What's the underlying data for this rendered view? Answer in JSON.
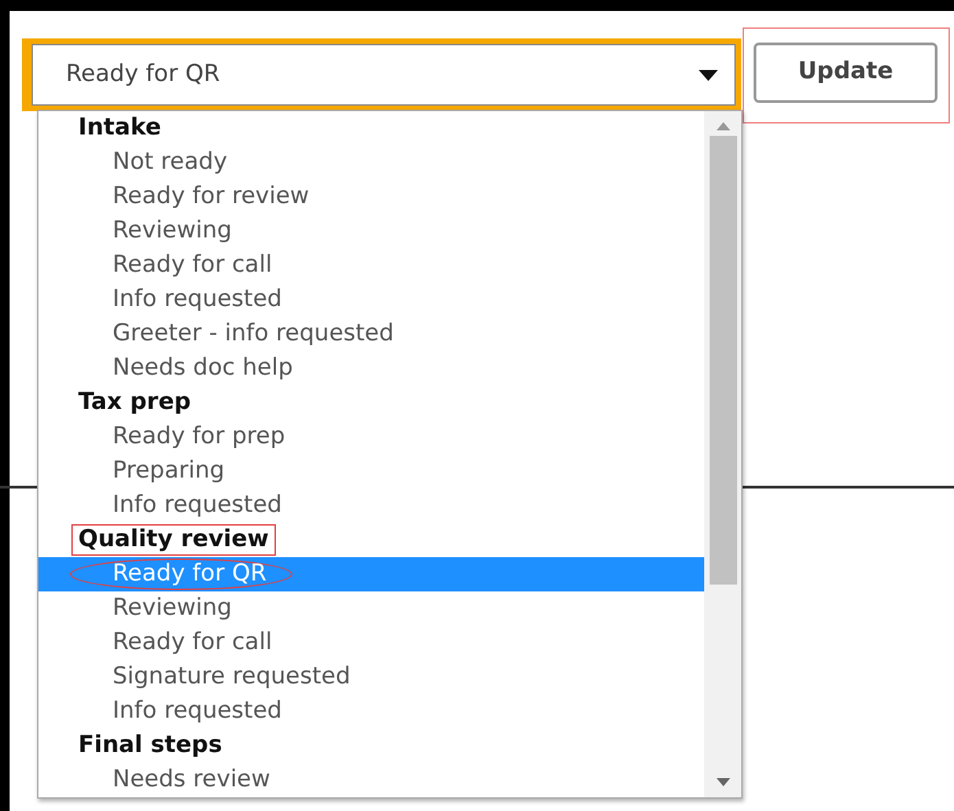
{
  "select": {
    "value": "Ready for QR",
    "focused": true,
    "open": true
  },
  "update_button": {
    "label": "Update",
    "marked": true
  },
  "groups": [
    {
      "label": "Intake",
      "marked": false,
      "options": [
        {
          "label": "Not ready",
          "selected": false,
          "marked": false
        },
        {
          "label": "Ready for review",
          "selected": false,
          "marked": false
        },
        {
          "label": "Reviewing",
          "selected": false,
          "marked": false
        },
        {
          "label": "Ready for call",
          "selected": false,
          "marked": false
        },
        {
          "label": "Info requested",
          "selected": false,
          "marked": false
        },
        {
          "label": "Greeter - info requested",
          "selected": false,
          "marked": false
        },
        {
          "label": "Needs doc help",
          "selected": false,
          "marked": false
        }
      ]
    },
    {
      "label": "Tax prep",
      "marked": false,
      "options": [
        {
          "label": "Ready for prep",
          "selected": false,
          "marked": false
        },
        {
          "label": "Preparing",
          "selected": false,
          "marked": false
        },
        {
          "label": "Info requested",
          "selected": false,
          "marked": false
        }
      ]
    },
    {
      "label": "Quality review",
      "marked": true,
      "options": [
        {
          "label": "Ready for QR",
          "selected": true,
          "marked": true
        },
        {
          "label": "Reviewing",
          "selected": false,
          "marked": false
        },
        {
          "label": "Ready for call",
          "selected": false,
          "marked": false
        },
        {
          "label": "Signature requested",
          "selected": false,
          "marked": false
        },
        {
          "label": "Info requested",
          "selected": false,
          "marked": false
        }
      ]
    },
    {
      "label": "Final steps",
      "marked": false,
      "options": [
        {
          "label": "Needs review",
          "selected": false,
          "marked": false
        }
      ]
    }
  ]
}
